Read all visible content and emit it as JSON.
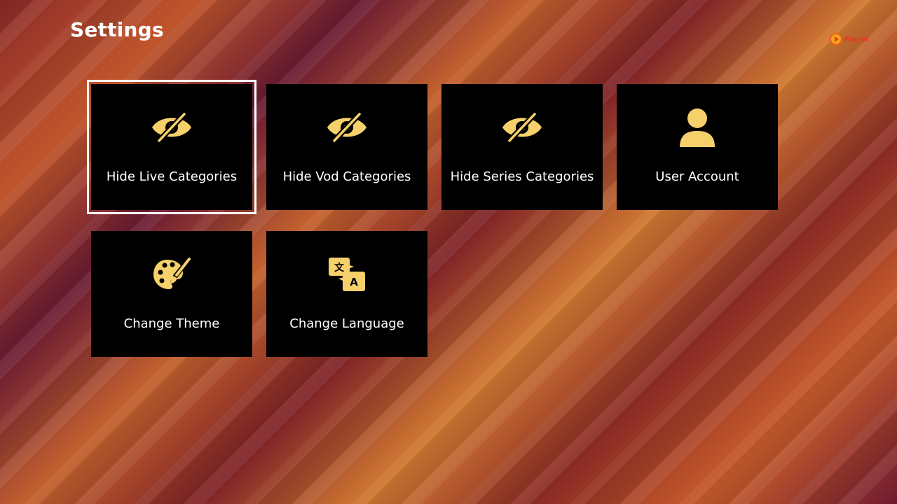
{
  "header": {
    "title": "Settings",
    "logo_text": "Player"
  },
  "theme": {
    "icon_color": "#f6d06a",
    "tile_background": "#000000",
    "focus_outline": "#ffffff"
  },
  "tiles": [
    {
      "label": "Hide Live Categories",
      "icon": "eye-off-icon",
      "focused": true
    },
    {
      "label": "Hide Vod Categories",
      "icon": "eye-off-icon",
      "focused": false
    },
    {
      "label": "Hide Series Categories",
      "icon": "eye-off-icon",
      "focused": false
    },
    {
      "label": "User Account",
      "icon": "user-icon",
      "focused": false
    },
    {
      "label": "Change Theme",
      "icon": "palette-icon",
      "focused": false
    },
    {
      "label": "Change Language",
      "icon": "translate-icon",
      "focused": false
    }
  ]
}
